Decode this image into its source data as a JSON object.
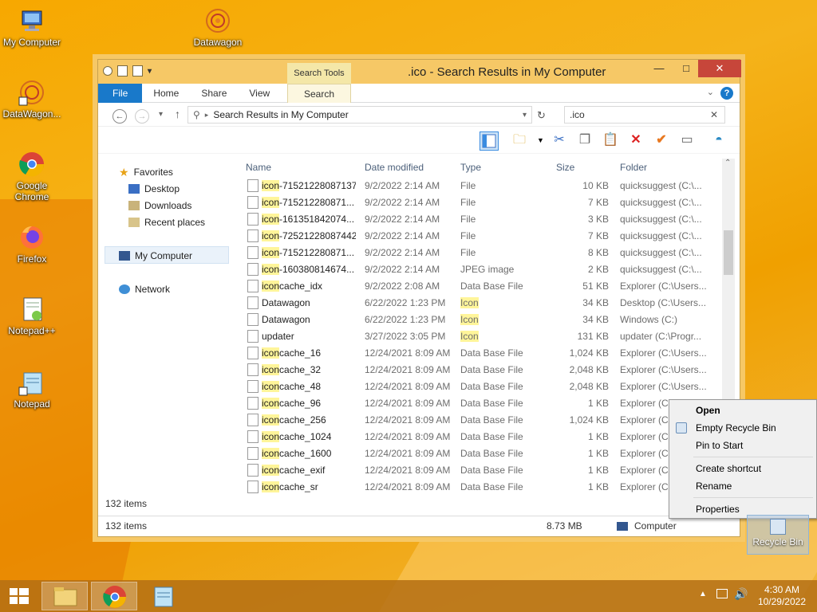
{
  "desktop": {
    "icons": [
      "My Computer",
      "Datawagon",
      "DataWagon...",
      "Google Chrome",
      "Firefox",
      "Notepad++",
      "Notepad"
    ],
    "recycle_bin": "Recycle Bin"
  },
  "window": {
    "title": ".ico - Search Results in My Computer",
    "contextual_tab_group": "Search Tools",
    "ribbon_tabs": [
      "File",
      "Home",
      "Share",
      "View",
      "Search"
    ],
    "address": "Search Results in My Computer",
    "search_value": ".ico",
    "nav": {
      "favorites": "Favorites",
      "desktop": "Desktop",
      "downloads": "Downloads",
      "recent": "Recent places",
      "my_computer": "My Computer",
      "network": "Network"
    },
    "columns": [
      "Name",
      "Date modified",
      "Type",
      "Size",
      "Folder"
    ],
    "files": [
      {
        "name": "icon-71521228087137",
        "date": "9/2/2022 2:14 AM",
        "type": "File",
        "size": "10 KB",
        "folder": "quicksuggest (C:\\...",
        "icon": "file-icon"
      },
      {
        "name": "icon-715212280871...",
        "date": "9/2/2022 2:14 AM",
        "type": "File",
        "size": "7 KB",
        "folder": "quicksuggest (C:\\...",
        "icon": "file-icon"
      },
      {
        "name": "icon-161351842074...",
        "date": "9/2/2022 2:14 AM",
        "type": "File",
        "size": "3 KB",
        "folder": "quicksuggest (C:\\...",
        "icon": "file-icon"
      },
      {
        "name": "icon-72521228087442",
        "date": "9/2/2022 2:14 AM",
        "type": "File",
        "size": "7 KB",
        "folder": "quicksuggest (C:\\...",
        "icon": "file-icon"
      },
      {
        "name": "icon-715212280871...",
        "date": "9/2/2022 2:14 AM",
        "type": "File",
        "size": "8 KB",
        "folder": "quicksuggest (C:\\...",
        "icon": "file-icon"
      },
      {
        "name": "icon-160380814674...",
        "date": "9/2/2022 2:14 AM",
        "type": "JPEG image",
        "size": "2 KB",
        "folder": "quicksuggest (C:\\...",
        "icon": "image-icon"
      },
      {
        "name": "iconcache_idx",
        "date": "9/2/2022 2:08 AM",
        "type": "Data Base File",
        "size": "51 KB",
        "folder": "Explorer (C:\\Users...",
        "icon": "db-icon"
      },
      {
        "name": "Datawagon",
        "date": "6/22/2022 1:23 PM",
        "type": "Icon",
        "size": "34 KB",
        "folder": "Desktop (C:\\Users...",
        "icon": "datawagon-icon"
      },
      {
        "name": "Datawagon",
        "date": "6/22/2022 1:23 PM",
        "type": "Icon",
        "size": "34 KB",
        "folder": "Windows (C:)",
        "icon": "datawagon-icon"
      },
      {
        "name": "updater",
        "date": "3/27/2022 3:05 PM",
        "type": "Icon",
        "size": "131 KB",
        "folder": "updater (C:\\Progr...",
        "icon": "updater-icon"
      },
      {
        "name": "iconcache_16",
        "date": "12/24/2021 8:09 AM",
        "type": "Data Base File",
        "size": "1,024 KB",
        "folder": "Explorer (C:\\Users...",
        "icon": "db-icon"
      },
      {
        "name": "iconcache_32",
        "date": "12/24/2021 8:09 AM",
        "type": "Data Base File",
        "size": "2,048 KB",
        "folder": "Explorer (C:\\Users...",
        "icon": "db-icon"
      },
      {
        "name": "iconcache_48",
        "date": "12/24/2021 8:09 AM",
        "type": "Data Base File",
        "size": "2,048 KB",
        "folder": "Explorer (C:\\Users...",
        "icon": "db-icon"
      },
      {
        "name": "iconcache_96",
        "date": "12/24/2021 8:09 AM",
        "type": "Data Base File",
        "size": "1 KB",
        "folder": "Explorer (C:\\",
        "icon": "db-icon"
      },
      {
        "name": "iconcache_256",
        "date": "12/24/2021 8:09 AM",
        "type": "Data Base File",
        "size": "1,024 KB",
        "folder": "Explorer (C:\\",
        "icon": "db-icon"
      },
      {
        "name": "iconcache_1024",
        "date": "12/24/2021 8:09 AM",
        "type": "Data Base File",
        "size": "1 KB",
        "folder": "Explorer (C:\\",
        "icon": "db-icon"
      },
      {
        "name": "iconcache_1600",
        "date": "12/24/2021 8:09 AM",
        "type": "Data Base File",
        "size": "1 KB",
        "folder": "Explorer (C:\\",
        "icon": "db-icon"
      },
      {
        "name": "iconcache_exif",
        "date": "12/24/2021 8:09 AM",
        "type": "Data Base File",
        "size": "1 KB",
        "folder": "Explorer (C:\\",
        "icon": "db-icon"
      },
      {
        "name": "iconcache_sr",
        "date": "12/24/2021 8:09 AM",
        "type": "Data Base File",
        "size": "1 KB",
        "folder": "Explorer (C:\\",
        "icon": "db-icon"
      }
    ],
    "status_count": "132 items",
    "details": {
      "count": "132 items",
      "size": "8.73 MB",
      "location": "Computer"
    }
  },
  "context_menu": {
    "items": [
      "Open",
      "Empty Recycle Bin",
      "Pin to Start",
      "Create shortcut",
      "Rename",
      "Properties"
    ]
  },
  "taskbar": {
    "time": "4:30 AM",
    "date": "10/29/2022"
  },
  "colors": {
    "accent": "#1979ca",
    "title_bar": "#f6c866",
    "highlight": "#fff59a"
  }
}
